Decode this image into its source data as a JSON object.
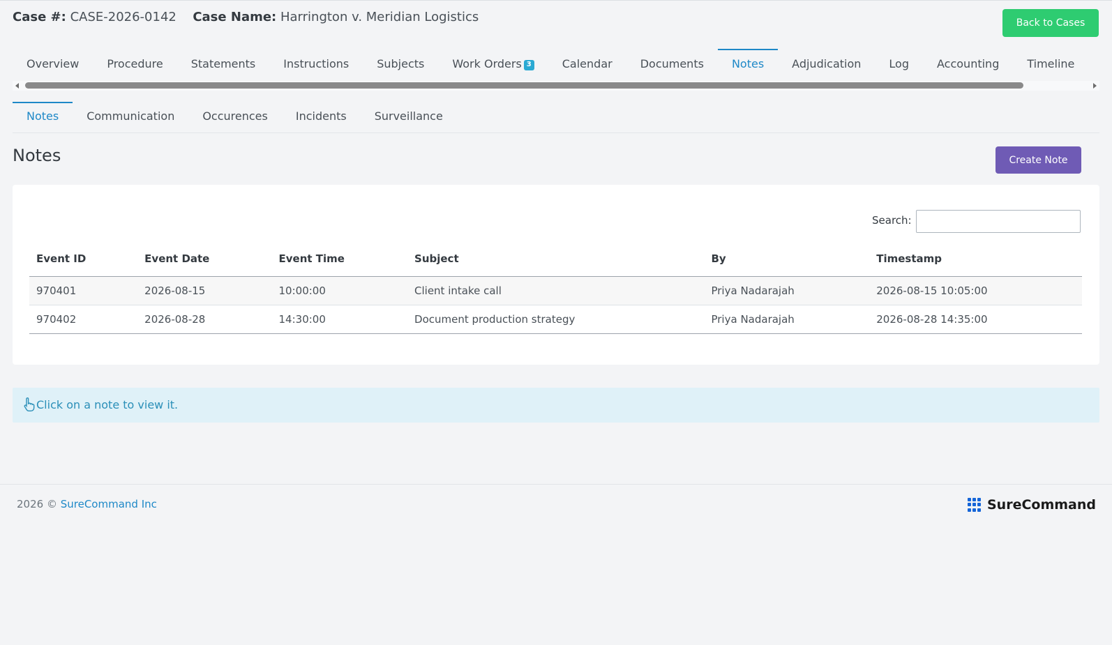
{
  "header": {
    "case_number_label": "Case #:",
    "case_number": "CASE-2026-0142",
    "case_name_label": "Case Name:",
    "case_name": "Harrington v. Meridian Logistics",
    "back_button": "Back to Cases"
  },
  "tabs": [
    {
      "label": "Overview"
    },
    {
      "label": "Procedure"
    },
    {
      "label": "Statements"
    },
    {
      "label": "Instructions"
    },
    {
      "label": "Subjects"
    },
    {
      "label": "Work Orders",
      "badge": "3"
    },
    {
      "label": "Calendar"
    },
    {
      "label": "Documents"
    },
    {
      "label": "Notes",
      "active": true
    },
    {
      "label": "Adjudication"
    },
    {
      "label": "Log"
    },
    {
      "label": "Accounting"
    },
    {
      "label": "Timeline"
    }
  ],
  "subtabs": [
    {
      "label": "Notes",
      "active": true
    },
    {
      "label": "Communication"
    },
    {
      "label": "Occurences"
    },
    {
      "label": "Incidents"
    },
    {
      "label": "Surveillance"
    }
  ],
  "section": {
    "title": "Notes",
    "create_button": "Create Note"
  },
  "search": {
    "label": "Search:",
    "value": ""
  },
  "table": {
    "columns": [
      "Event ID",
      "Event Date",
      "Event Time",
      "Subject",
      "By",
      "Timestamp"
    ],
    "rows": [
      [
        "970401",
        "2026-08-15",
        "10:00:00",
        "Client intake call",
        "Priya Nadarajah",
        "2026-08-15 10:05:00"
      ],
      [
        "970402",
        "2026-08-28",
        "14:30:00",
        "Document production strategy",
        "Priya Nadarajah",
        "2026-08-28 14:35:00"
      ]
    ]
  },
  "info": {
    "icon": "pointer-hand-icon",
    "message": "Click on a note to view it."
  },
  "footer": {
    "copyright": "2026 ©",
    "company_link": "SureCommand Inc",
    "brand": "SureCommand"
  },
  "colors": {
    "accent": "#1e88c7",
    "back_button": "#2ecc71",
    "create_button": "#6f5bb5",
    "info_bg": "#dff1f8"
  }
}
